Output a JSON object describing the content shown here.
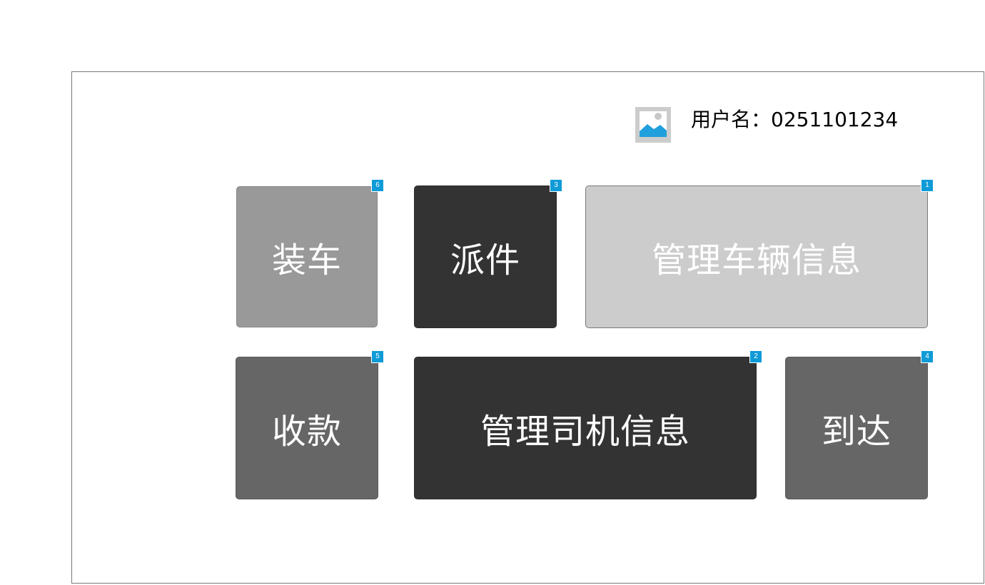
{
  "header": {
    "avatar_icon": "image-placeholder-icon",
    "username_text": "用户名：0251101234"
  },
  "tiles": [
    {
      "label": "装车",
      "badge": "6",
      "color": "#999999"
    },
    {
      "label": "派件",
      "badge": "3",
      "color": "#333333"
    },
    {
      "label": "管理车辆信息",
      "badge": "1",
      "color": "#cccccc"
    },
    {
      "label": "收款",
      "badge": "5",
      "color": "#666666"
    },
    {
      "label": "管理司机信息",
      "badge": "2",
      "color": "#333333"
    },
    {
      "label": "到达",
      "badge": "4",
      "color": "#666666"
    }
  ],
  "colors": {
    "badge": "#0f9bd7",
    "frame_border": "#797979"
  }
}
